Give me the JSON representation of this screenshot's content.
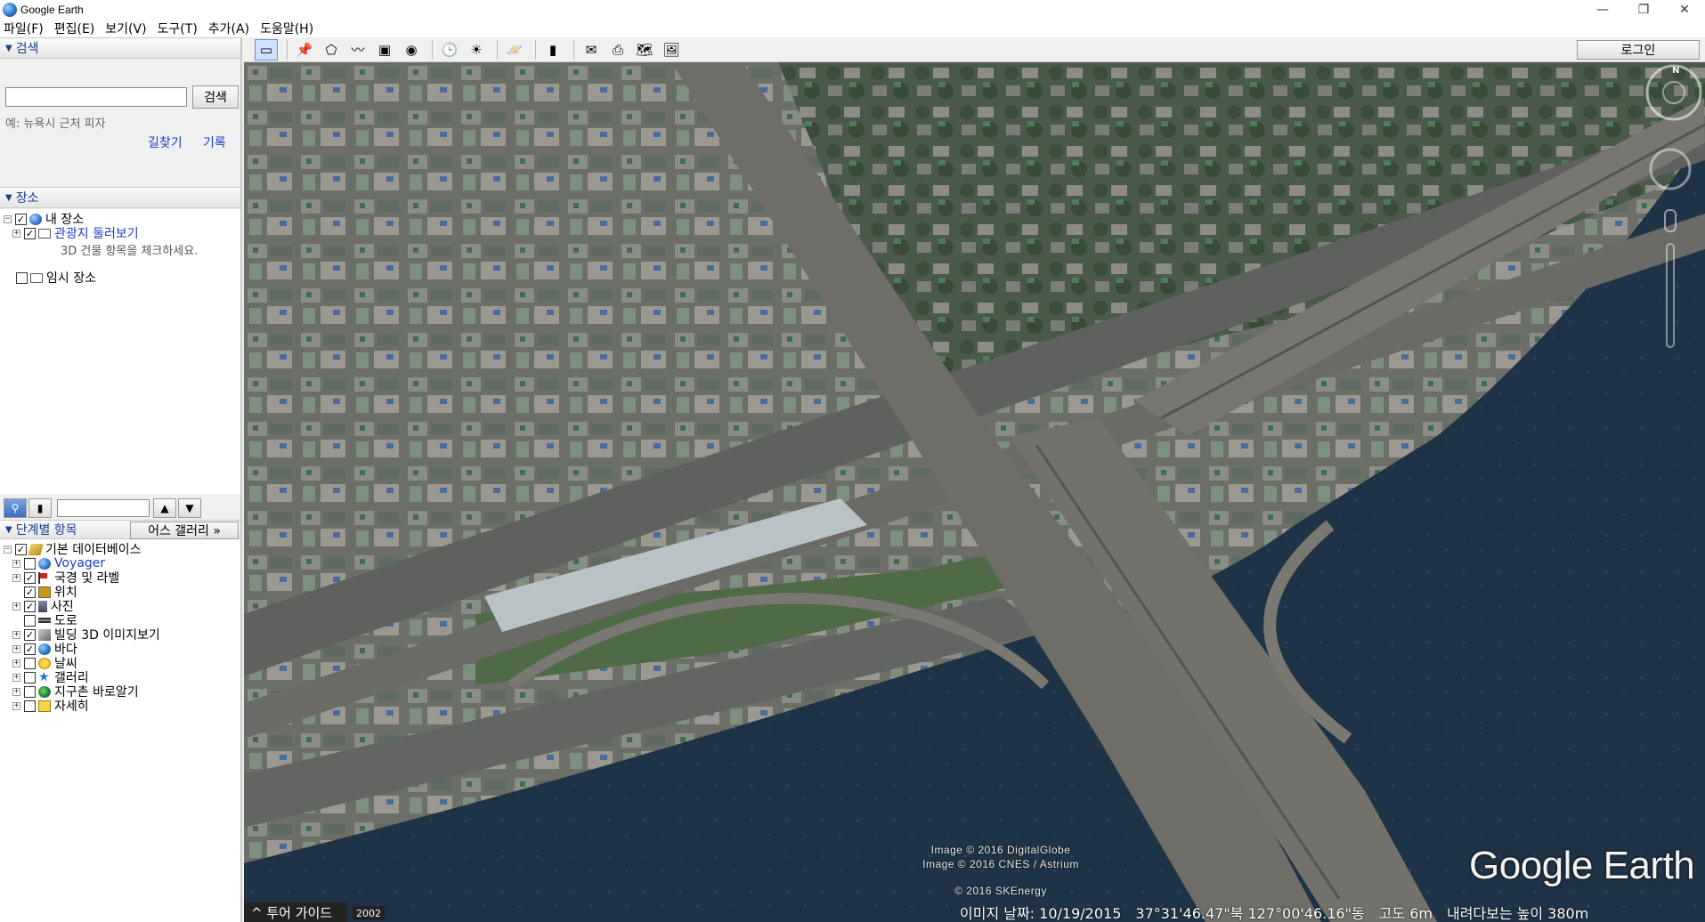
{
  "window": {
    "title": "Google Earth",
    "controls": [
      "—",
      "❐",
      "✕"
    ]
  },
  "menu": [
    "파일(F)",
    "편집(E)",
    "보기(V)",
    "도구(T)",
    "추가(A)",
    "도움말(H)"
  ],
  "search": {
    "header": "검색",
    "input_value": "",
    "button": "검색",
    "example": "예: 뉴욕시 근처 피자",
    "directions": "길찾기",
    "history": "기록"
  },
  "places": {
    "header": "장소",
    "my_places": "내 장소",
    "sightseeing": "관광지 둘러보기",
    "sightseeing_note": "3D 건물 항목을 체크하세요.",
    "temporary": "임시 장소"
  },
  "layers": {
    "header": "단계별 항목",
    "gallery_button": "어스 갤러리 »",
    "items": [
      {
        "label": "기본 데이터베이스",
        "checked": true,
        "icon": "database-icon"
      },
      {
        "label": "Voyager",
        "checked": false,
        "icon": "voyager-icon"
      },
      {
        "label": "국경 및 라벨",
        "checked": true,
        "icon": "flag-icon"
      },
      {
        "label": "위치",
        "checked": true,
        "icon": "location-icon"
      },
      {
        "label": "사진",
        "checked": true,
        "icon": "photo-icon"
      },
      {
        "label": "도로",
        "checked": false,
        "icon": "road-icon"
      },
      {
        "label": "빌딩 3D 이미지보기",
        "checked": true,
        "icon": "building-icon"
      },
      {
        "label": "바다",
        "checked": true,
        "icon": "ocean-icon"
      },
      {
        "label": "날씨",
        "checked": false,
        "icon": "weather-icon"
      },
      {
        "label": "갤러리",
        "checked": false,
        "icon": "gallery-icon"
      },
      {
        "label": "지구촌 바로알기",
        "checked": false,
        "icon": "global-awareness-icon"
      },
      {
        "label": "자세히",
        "checked": false,
        "icon": "more-icon"
      }
    ]
  },
  "toolbar": {
    "login": "로그인",
    "tools": [
      "sidebar-icon",
      "placemark-icon",
      "polygon-icon",
      "path-icon",
      "overlay-icon",
      "tour-icon",
      "historical-imagery-icon",
      "sunlight-icon",
      "planets-icon",
      "ruler-icon",
      "email-icon",
      "print-icon",
      "view-in-maps-icon",
      "save-image-icon"
    ]
  },
  "map": {
    "copyright": [
      "Image © 2016 DigitalGlobe",
      "Image © 2016 CNES / Astrium",
      "© 2016 SKEnergy"
    ],
    "logo": "Google Earth",
    "tour_guide": "^ 투어 가이드",
    "year": "2002",
    "status": {
      "date": "이미지 날짜: 10/19/2015",
      "coords": "37°31'46.47\"북 127°00'46.16\"동",
      "elevation": "고도  6m",
      "eye_alt": "내려다보는 높이  380m"
    },
    "compass_label": "N"
  },
  "colors": {
    "link": "#1a3ec8",
    "header_text": "#1a3e8c",
    "river": "#1f3346",
    "road": "#6a6a66"
  }
}
